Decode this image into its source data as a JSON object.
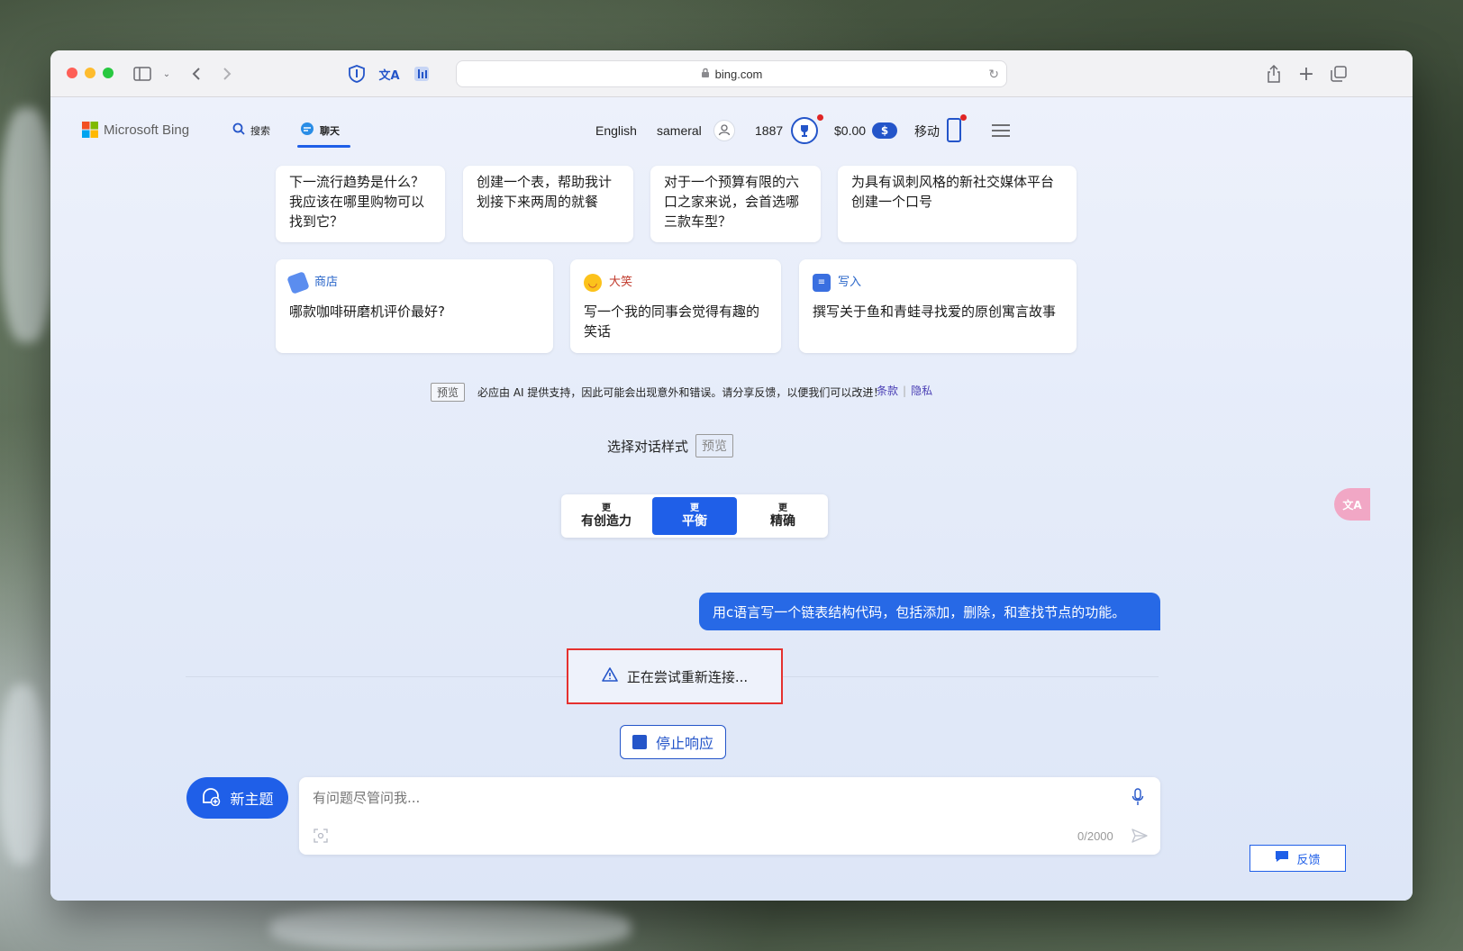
{
  "browser": {
    "url": "bing.com"
  },
  "header": {
    "logo_text": "Microsoft Bing",
    "nav": [
      {
        "label": "搜索",
        "icon": "search-icon"
      },
      {
        "label": "聊天",
        "icon": "chat-icon",
        "active": true
      }
    ],
    "language": "English",
    "username": "sameral",
    "points": "1887",
    "balance": "$0.00",
    "mobile_label": "移动"
  },
  "prompt_cards_top": [
    {
      "text": "下一流行趋势是什么？我应该在哪里购物可以找到它？"
    },
    {
      "text": "创建一个表，帮助我计划接下来两周的就餐"
    },
    {
      "text": "对于一个预算有限的六口之家来说，会首选哪三款车型？"
    },
    {
      "text": "为具有讽刺风格的新社交媒体平台创建一个口号"
    }
  ],
  "prompt_cards_bottom": [
    {
      "category": "商店",
      "text": "哪款咖啡研磨机评价最好?",
      "icon": "tag-icon"
    },
    {
      "category": "大笑",
      "text": "写一个我的同事会觉得有趣的笑话",
      "icon": "laugh-emoji-icon"
    },
    {
      "category": "写入",
      "text": "撰写关于鱼和青蛙寻找爱的原创寓言故事",
      "icon": "write-icon"
    }
  ],
  "disclaimer": {
    "badge": "预览",
    "text": "必应由 AI 提供支持，因此可能会出现意外和错误。请分享反馈，以便我们可以改进！",
    "terms_link": "条款",
    "privacy_link": "隐私"
  },
  "tone_selector": {
    "title": "选择对话样式",
    "badge": "预览",
    "options": [
      {
        "prefix": "更",
        "label": "有创造力"
      },
      {
        "prefix": "更",
        "label": "平衡",
        "active": true
      },
      {
        "prefix": "更",
        "label": "精确"
      }
    ]
  },
  "chat": {
    "user_message": "用c语言写一个链表结构代码，包括添加，删除，和查找节点的功能。",
    "status": "正在尝试重新连接...",
    "stop_button": "停止响应"
  },
  "composer": {
    "new_topic": "新主题",
    "placeholder": "有问题尽管问我...",
    "counter": "0/2000"
  },
  "feedback_label": "反馈",
  "colors": {
    "accent": "#1f5fe8",
    "highlight_border": "#e5312f",
    "notification_dot": "#e02424"
  }
}
